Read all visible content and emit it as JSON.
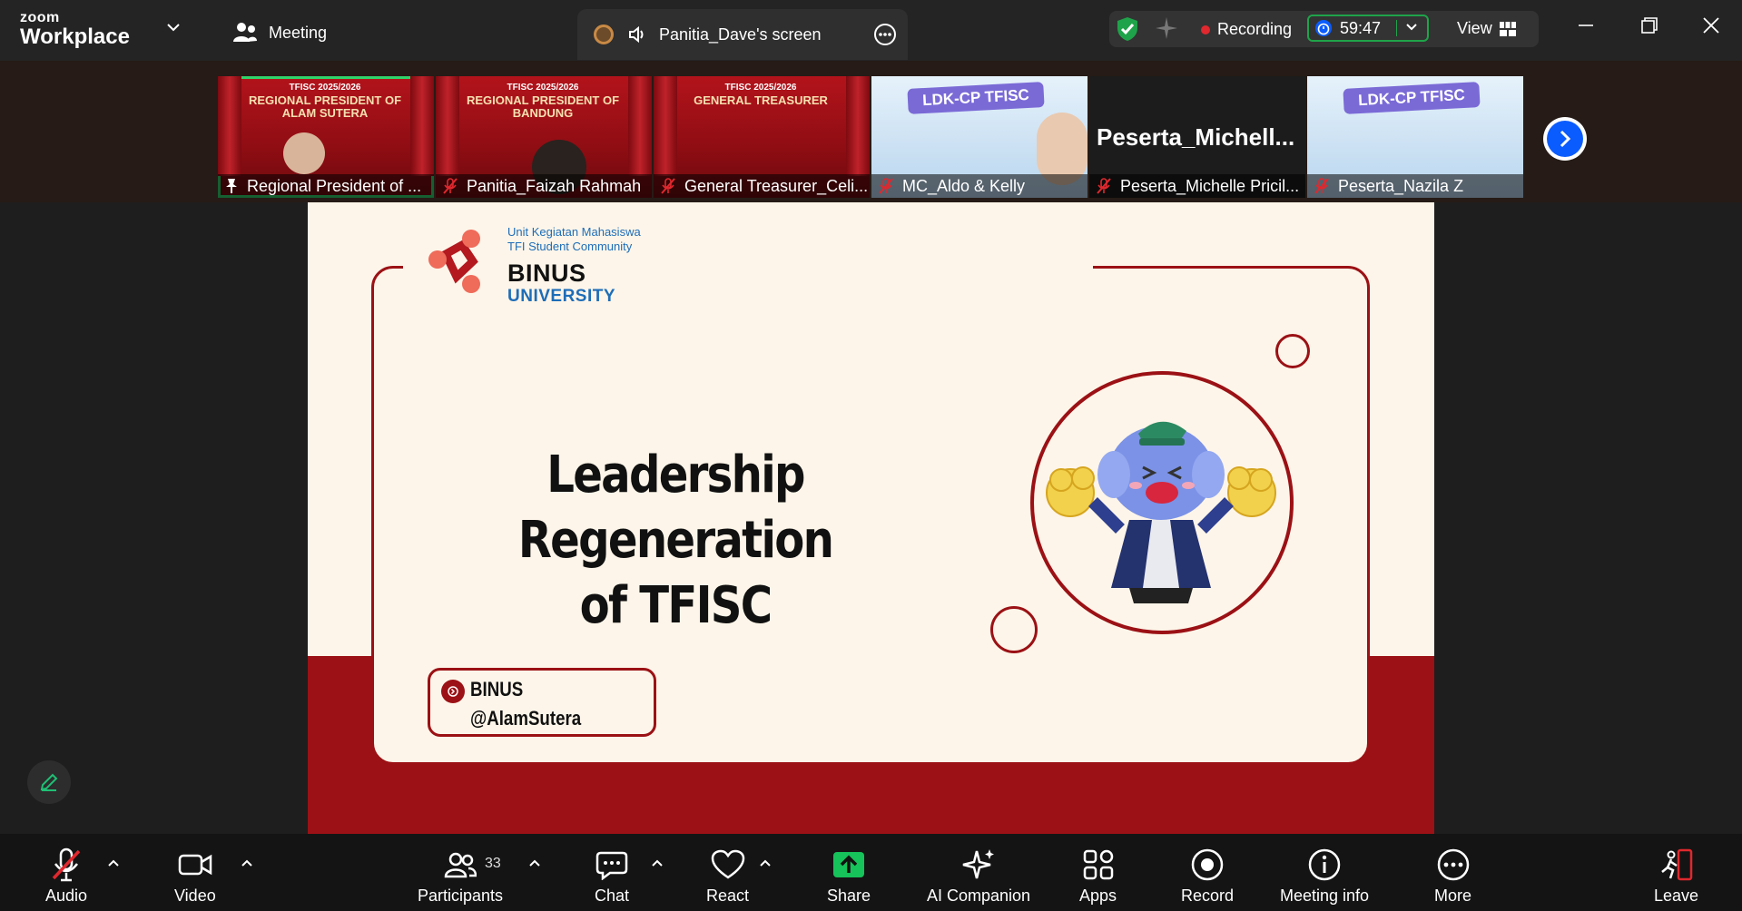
{
  "app": {
    "brand_top": "zoom",
    "brand_bottom": "Workplace"
  },
  "header": {
    "meeting_label": "Meeting",
    "share_label": "Panitia_Dave's screen",
    "recording_label": "Recording",
    "timer": "59:47",
    "view_label": "View"
  },
  "thumbnails": [
    {
      "label": "Regional President of ...",
      "banner_year": "TFISC 2025/2026",
      "banner": "REGIONAL PRESIDENT OF ALAM SUTERA"
    },
    {
      "label": "Panitia_Faizah Rahmah",
      "banner_year": "TFISC 2025/2026",
      "banner": "REGIONAL PRESIDENT OF BANDUNG"
    },
    {
      "label": "General Treasurer_Celi...",
      "banner_year": "TFISC 2025/2026",
      "banner": "GENERAL TREASURER"
    },
    {
      "label": "MC_Aldo & Kelly",
      "banner": "LDK-CP TFISC"
    },
    {
      "label": "Peserta_Michelle Pricil...",
      "big_name": "Peserta_Michell..."
    },
    {
      "label": "Peserta_Nazila Z",
      "banner": "LDK-CP TFISC"
    }
  ],
  "slide": {
    "org_line1": "Unit Kegiatan Mahasiswa",
    "org_line2": "TFI Student Community",
    "binus": "BINUS",
    "university": "UNIVERSITY",
    "title_line1": "Leadership Regeneration",
    "title_line2": "of TFISC",
    "handle_line1": "BINUS",
    "handle_line2": "@AlamSutera"
  },
  "toolbar": {
    "audio": "Audio",
    "video": "Video",
    "participants": "Participants",
    "participants_count": "33",
    "chat": "Chat",
    "react": "React",
    "share": "Share",
    "ai_companion": "AI Companion",
    "apps": "Apps",
    "record": "Record",
    "meeting_info": "Meeting info",
    "more": "More",
    "leave": "Leave"
  },
  "colors": {
    "accent_green": "#1fa34a",
    "brand_red": "#9b1115",
    "zoom_blue": "#0b5cff",
    "recording_red": "#e0282e"
  }
}
